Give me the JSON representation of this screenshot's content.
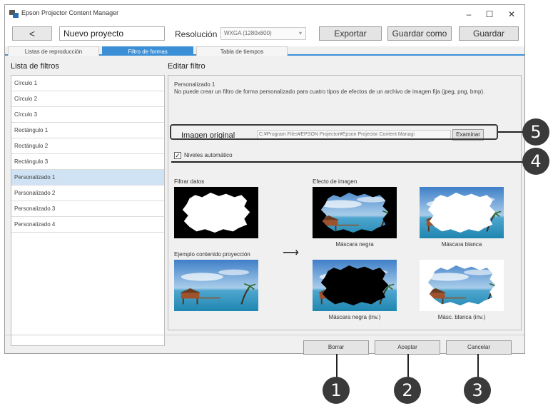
{
  "window": {
    "title": "Epson Projector Content Manager",
    "controls": {
      "minimize": "–",
      "maximize": "☐",
      "close": "✕"
    }
  },
  "toolbar": {
    "back": "<",
    "project_name": "Nuevo proyecto",
    "resolution_label": "Resolución :",
    "resolution_value": "WXGA (1280x800)",
    "export": "Exportar",
    "save_as": "Guardar como",
    "save": "Guardar"
  },
  "tabs": [
    {
      "label": "Listas de reproducción",
      "active": false
    },
    {
      "label": "Filtro de formas",
      "active": true
    },
    {
      "label": "Tabla de tiempos",
      "active": false
    }
  ],
  "filter_list": {
    "title": "Lista de filtros",
    "items": [
      "Círculo 1",
      "Círculo 2",
      "Círculo 3",
      "Rectángulo 1",
      "Rectángulo 2",
      "Rectángulo 3",
      "Personalizado 1",
      "Personalizado 2",
      "Personalizado 3",
      "Personalizado 4"
    ],
    "selected": "Personalizado 1"
  },
  "editor": {
    "title": "Editar filtro",
    "filter_name": "Personalizado 1",
    "note": "No puede crear un filtro de forma personalizado para cuatro tipos de efectos de un archivo de imagen fija (jpeg, png, bmp).",
    "original_label": "Imagen original",
    "original_path": "C:¥Program Files¥EPSON Projector¥Epson Projector Content Managi",
    "browse": "Examinar",
    "auto_levels": "Niveles automático",
    "auto_levels_checked": true,
    "filter_data_label": "Filtrar datos",
    "image_effect_label": "Efecto de imagen",
    "projection_sample_label": "Ejemplo contenido proyección",
    "arrow": "⟶",
    "effects": {
      "black_mask": "Máscara negra",
      "white_mask": "Máscara blanca",
      "black_mask_inv": "Máscara negra (inv.)",
      "white_mask_inv": "Másc. blanca (inv.)"
    }
  },
  "footer": {
    "delete": "Borrar",
    "accept": "Aceptar",
    "cancel": "Cancelar"
  },
  "callouts": [
    "1",
    "2",
    "3",
    "4",
    "5"
  ],
  "colors": {
    "accent": "#3b8fd6",
    "selected_row": "#cfe3f5",
    "callout": "#3a3a3a",
    "sky": "#4f8fd0",
    "sea": "#2f9ac0"
  }
}
